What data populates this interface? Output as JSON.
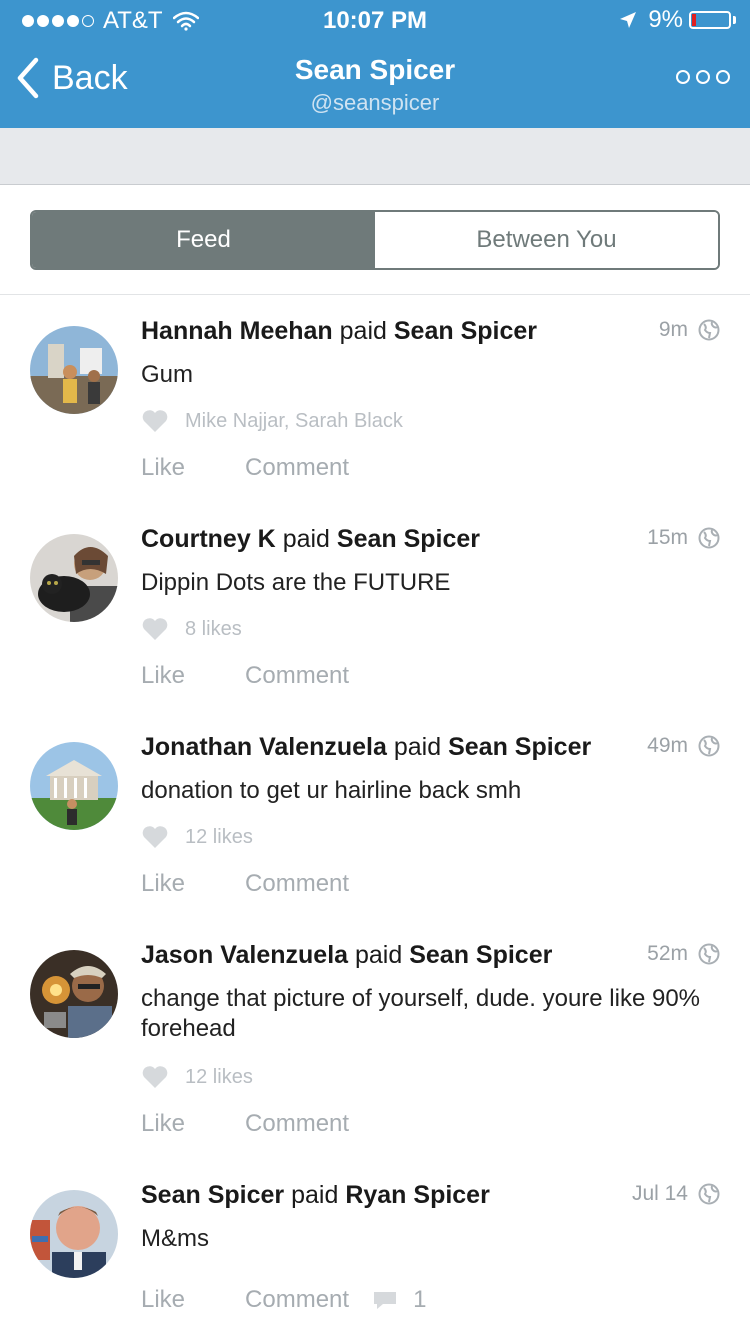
{
  "status_bar": {
    "carrier": "AT&T",
    "time": "10:07 PM",
    "battery_percent": "9%",
    "signal_bars": 4,
    "signal_total": 5
  },
  "nav": {
    "back_label": "Back",
    "title": "Sean Spicer",
    "subtitle": "@seanspicer",
    "more_icon": "ellipsis-icon"
  },
  "tabs": [
    {
      "label": "Feed",
      "active": true
    },
    {
      "label": "Between You",
      "active": false
    }
  ],
  "colors": {
    "brand": "#3d95ce",
    "segment": "#6f7a7a",
    "muted": "#a6acb1",
    "battery_low": "#e02020"
  },
  "stories": [
    {
      "actor": "Hannah Meehan",
      "verb": "paid",
      "target": "Sean Spicer",
      "time": "9m",
      "note": "Gum",
      "likes": "Mike Najjar, Sarah Black",
      "like_label": "Like",
      "comment_label": "Comment",
      "comment_count": ""
    },
    {
      "actor": "Courtney K",
      "verb": "paid",
      "target": "Sean Spicer",
      "time": "15m",
      "note": "Dippin Dots are the FUTURE",
      "likes": "8 likes",
      "like_label": "Like",
      "comment_label": "Comment",
      "comment_count": ""
    },
    {
      "actor": "Jonathan Valenzuela",
      "verb": "paid",
      "target": "Sean Spicer",
      "time": "49m",
      "note": "donation to get ur hairline back smh",
      "likes": "12 likes",
      "like_label": "Like",
      "comment_label": "Comment",
      "comment_count": ""
    },
    {
      "actor": "Jason Valenzuela",
      "verb": "paid",
      "target": "Sean Spicer",
      "time": "52m",
      "note": "change that picture of yourself, dude. youre like 90% forehead",
      "likes": "12 likes",
      "like_label": "Like",
      "comment_label": "Comment",
      "comment_count": ""
    },
    {
      "actor": "Sean Spicer",
      "verb": "paid",
      "target": "Ryan Spicer",
      "time": "Jul 14",
      "note": "M&ms",
      "likes": "",
      "like_label": "Like",
      "comment_label": "Comment",
      "comment_count": "1"
    }
  ]
}
